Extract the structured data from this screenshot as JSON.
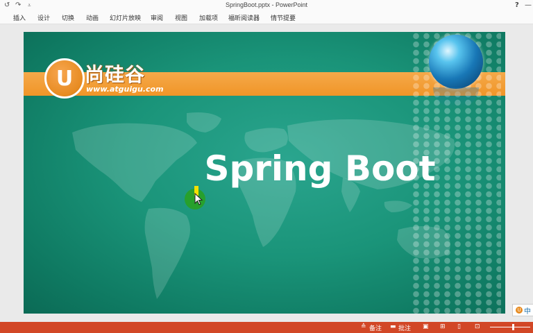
{
  "window": {
    "title": "SpringBoot.pptx - PowerPoint",
    "help": "?",
    "minimize": "—"
  },
  "quick_access": {
    "undo_icon": "↺",
    "redo_icon": "↷",
    "customize_icon": "⩡"
  },
  "ribbon": {
    "tabs": [
      "插入",
      "设计",
      "切换",
      "动画",
      "幻灯片放映",
      "审阅",
      "视图",
      "加载项",
      "福昕阅读器",
      "情节提要"
    ]
  },
  "slide": {
    "logo_letter": "U",
    "logo_text": "尚硅谷",
    "logo_url": "www.atguigu.com",
    "title": "Spring Boot"
  },
  "corner_badge": {
    "text": "中"
  },
  "statusbar": {
    "notes": "备注",
    "comments": "批注"
  },
  "colors": {
    "accent_status": "#d24726",
    "slide_teal": "#1a9479",
    "band_orange": "#f09528"
  }
}
